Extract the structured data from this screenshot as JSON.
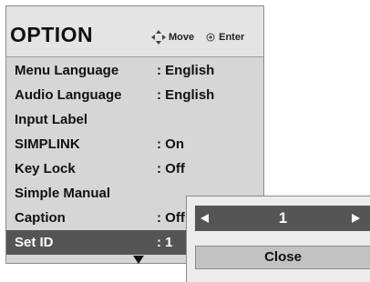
{
  "menu": {
    "title": "OPTION",
    "hint": {
      "move_icon": "four-way-arrow-icon",
      "move_label": "Move",
      "enter_icon": "enter-circle-icon",
      "enter_label": "Enter"
    },
    "items": [
      {
        "label": "Menu Language",
        "value": ": English"
      },
      {
        "label": "Audio Language",
        "value": ": English"
      },
      {
        "label": "Input Label",
        "value": ""
      },
      {
        "label": "SIMPLINK",
        "value": ": On"
      },
      {
        "label": "Key Lock",
        "value": ": Off"
      },
      {
        "label": "Simple Manual",
        "value": ""
      },
      {
        "label": "Caption",
        "value": ": Off"
      },
      {
        "label": "Set ID",
        "value": ": 1"
      }
    ],
    "selected_index": 7,
    "more_below_icon": "down-arrow-icon"
  },
  "popup": {
    "value": "1",
    "left_icon": "left-arrow-icon",
    "right_icon": "right-arrow-icon",
    "close_label": "Close"
  },
  "colors": {
    "menu_background": "#d6d6d6",
    "header_background": "#e4e4e4",
    "highlight": "#555555",
    "button": "#c2c2c2"
  }
}
